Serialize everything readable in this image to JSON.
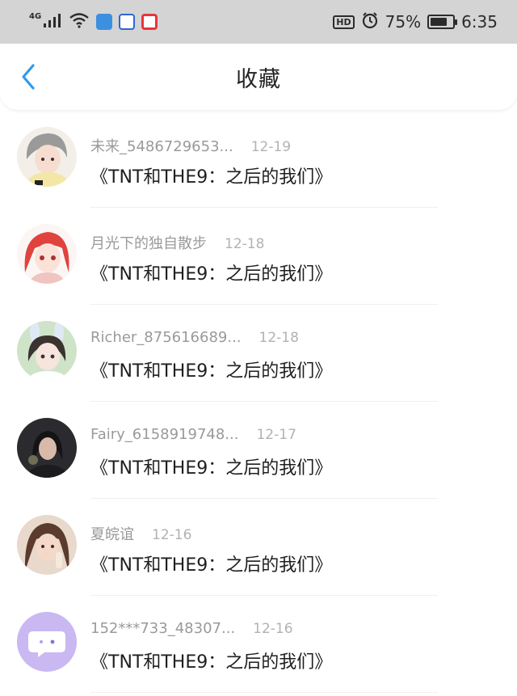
{
  "status_bar": {
    "network": "4G",
    "battery_percent": "75%",
    "time": "6:35",
    "hd": "HD",
    "battery_level": 0.75
  },
  "nav": {
    "title": "收藏"
  },
  "items": [
    {
      "username": "未来_5486729653...",
      "date": "12-19",
      "title": "《TNT和THE9：之后的我们》"
    },
    {
      "username": "月光下的独自散步",
      "date": "12-18",
      "title": "《TNT和THE9：之后的我们》"
    },
    {
      "username": "Richer_875616689...",
      "date": "12-18",
      "title": "《TNT和THE9：之后的我们》"
    },
    {
      "username": "Fairy_6158919748...",
      "date": "12-17",
      "title": "《TNT和THE9：之后的我们》"
    },
    {
      "username": "夏皖谊",
      "date": "12-16",
      "title": "《TNT和THE9：之后的我们》"
    },
    {
      "username": "152***733_48307...",
      "date": "12-16",
      "title": "《TNT和THE9：之后的我们》"
    }
  ],
  "colors": {
    "accent": "#2f9bf0",
    "status_bar_bg": "#d4d4d4"
  }
}
